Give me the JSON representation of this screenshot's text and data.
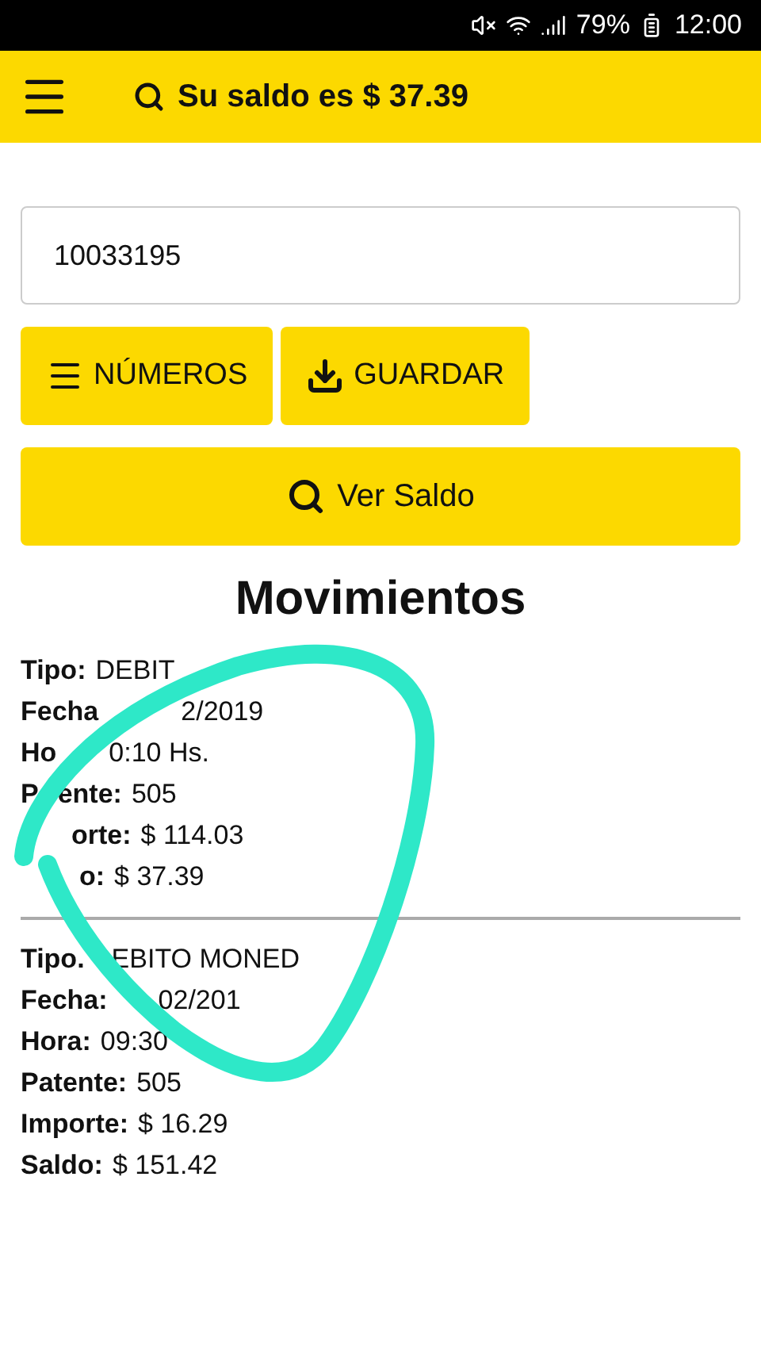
{
  "status_bar": {
    "battery": "79%",
    "time": "12:00"
  },
  "header": {
    "title": "Su saldo es $ 37.39"
  },
  "search": {
    "value": "10033195"
  },
  "buttons": [
    {
      "kind": "menu",
      "label": "NÚMEROS"
    },
    {
      "kind": "download",
      "label": "GUARDAR"
    }
  ],
  "primary_button": {
    "label": "Ver Saldo"
  },
  "section_title": "Movimientos",
  "movements": [
    {
      "lines": [
        [
          {
            "text": "Tipo:",
            "kind": "label"
          },
          {
            "text": "DEBIT",
            "kind": "value"
          }
        ],
        [
          {
            "text": "Fecha",
            "kind": "label"
          },
          {
            "text": "2/2019",
            "kind": "value"
          }
        ],
        [
          {
            "text": "Ho",
            "kind": "label"
          },
          {
            "text": "0:10 Hs.",
            "kind": "value"
          }
        ],
        [
          {
            "text": "P",
            "kind": "label"
          },
          {
            "text": "ente:",
            "kind": "label"
          },
          {
            "text": "505",
            "kind": "value"
          }
        ],
        [
          {
            "text": "orte:",
            "kind": "label"
          },
          {
            "text": "$ 114.03",
            "kind": "value"
          }
        ],
        [
          {
            "text": "o:",
            "kind": "label"
          },
          {
            "text": "$ 37.39",
            "kind": "value"
          }
        ]
      ]
    },
    {
      "lines": [
        [
          {
            "text": "Tipo.",
            "kind": "label"
          },
          {
            "text": "EBITO MONED",
            "kind": "value"
          }
        ],
        [
          {
            "text": "Fecha:",
            "kind": "label"
          },
          {
            "text": "02/201",
            "kind": "value"
          }
        ],
        [
          {
            "text": "Hora:",
            "kind": "label"
          },
          {
            "text": "09:30",
            "kind": "value"
          }
        ],
        [
          {
            "text": "Patente:",
            "kind": "label"
          },
          {
            "text": "505",
            "kind": "value"
          }
        ],
        [
          {
            "text": "Importe:",
            "kind": "label"
          },
          {
            "text": "$ 16.29",
            "kind": "value"
          }
        ],
        [
          {
            "text": "Saldo:",
            "kind": "label"
          },
          {
            "text": "$ 151.42",
            "kind": "value"
          }
        ]
      ]
    }
  ]
}
